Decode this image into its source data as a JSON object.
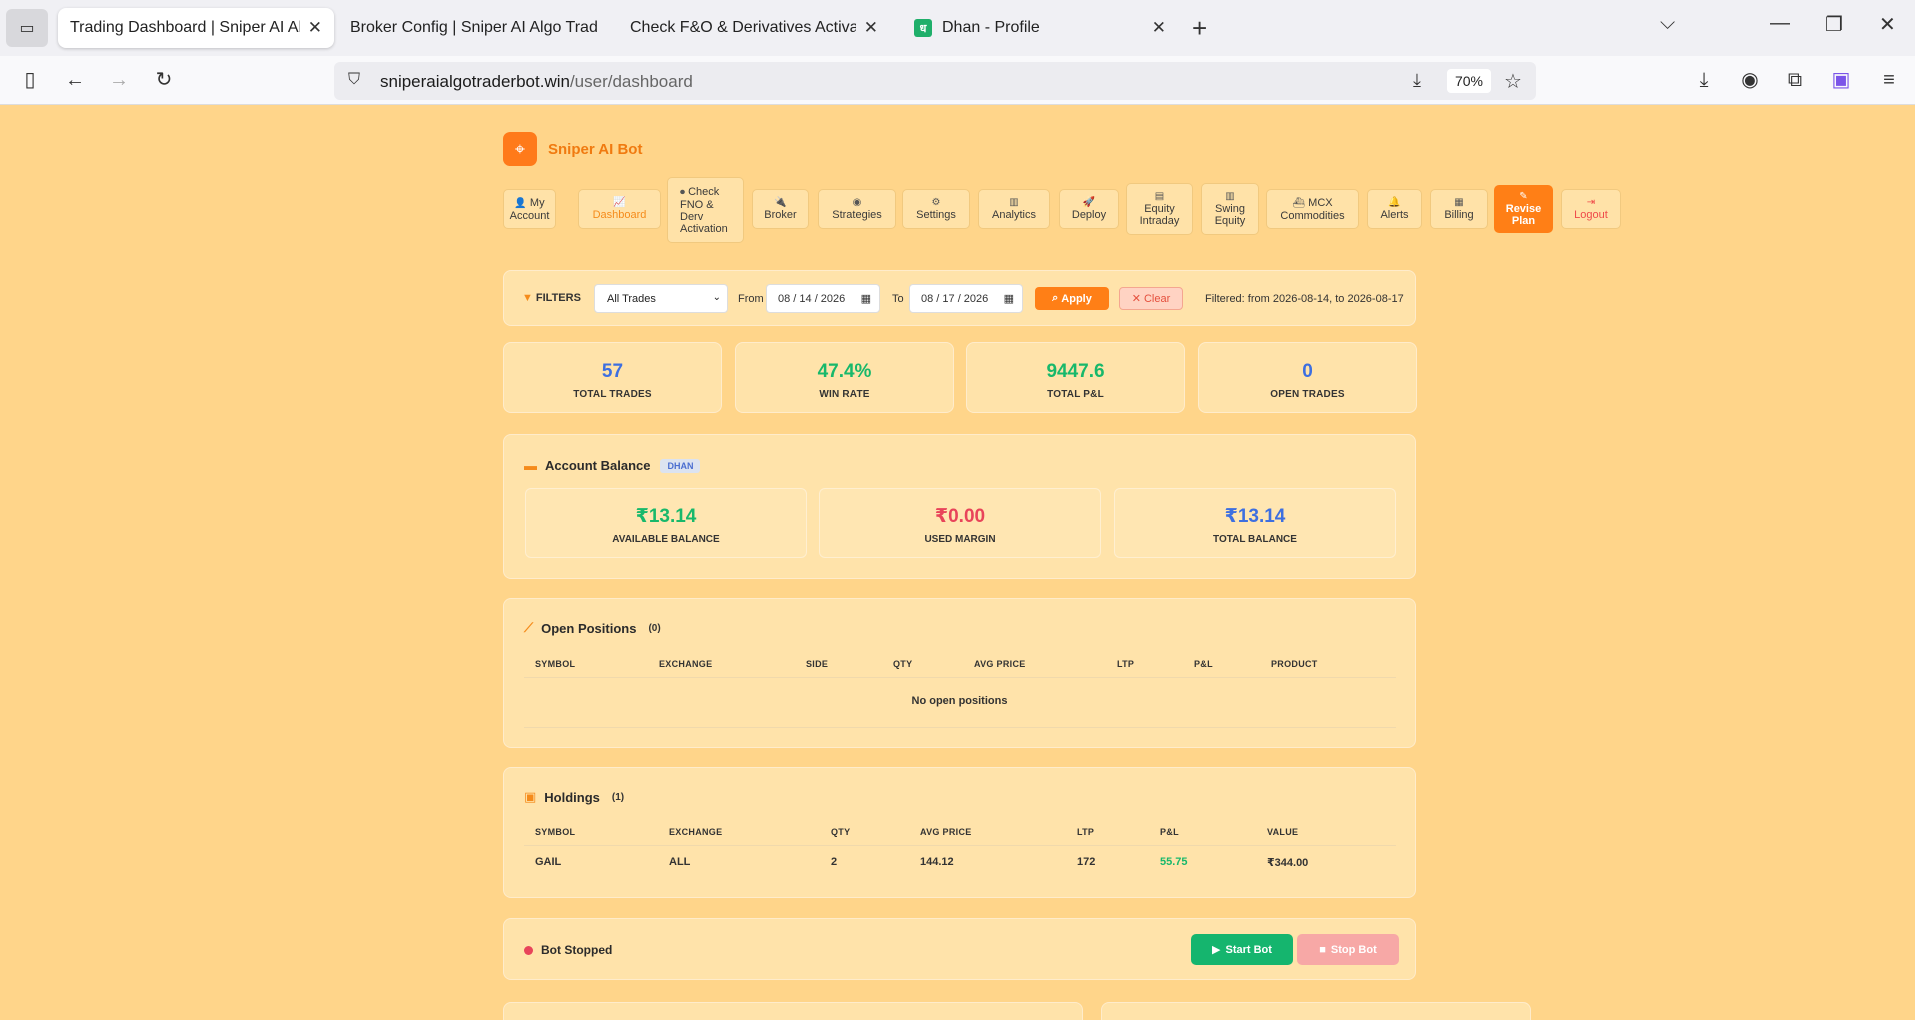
{
  "browser": {
    "tabs": [
      {
        "title": "Trading Dashboard | Sniper AI Algo",
        "active": true
      },
      {
        "title": "Broker Config | Sniper AI Algo Trade",
        "active": false
      },
      {
        "title": "Check F&O & Derivatives Activation",
        "active": false
      },
      {
        "title": "Dhan - Profile",
        "active": false
      }
    ],
    "url_domain": "sniperaialgotraderbot.win",
    "url_path": "/user/dashboard",
    "zoom": "70%"
  },
  "brand": {
    "name": "Sniper AI Bot"
  },
  "menu": [
    {
      "line1": "My",
      "line2": "Account",
      "icon": "user-icon",
      "glyph": "👤"
    },
    {
      "line1": "",
      "line2": "Dashboard",
      "icon": "chart-icon",
      "glyph": "📈",
      "active": true
    },
    {
      "line1": "Check",
      "line2": "FNO & Derv Activation",
      "icon": "toggle-icon",
      "glyph": "⏺"
    },
    {
      "line1": "",
      "line2": "Broker",
      "icon": "plug-icon",
      "glyph": "🔌"
    },
    {
      "line1": "",
      "line2": "Strategies",
      "icon": "brain-icon",
      "glyph": "◉"
    },
    {
      "line1": "",
      "line2": "Settings",
      "icon": "gear-icon",
      "glyph": "⚙"
    },
    {
      "line1": "",
      "line2": "Analytics",
      "icon": "analytics-icon",
      "glyph": "▥"
    },
    {
      "line1": "",
      "line2": "Deploy",
      "icon": "rocket-icon",
      "glyph": "🚀"
    },
    {
      "line1": "Equity",
      "line2": "Intraday",
      "icon": "line-chart-icon",
      "glyph": "▤"
    },
    {
      "line1": "Swing",
      "line2": "Equity",
      "icon": "bar-chart-icon",
      "glyph": "▥"
    },
    {
      "line1": "MCX",
      "line2": "Commodities",
      "icon": "ship-icon",
      "glyph": "⛴"
    },
    {
      "line1": "",
      "line2": "Alerts",
      "icon": "bell-icon",
      "glyph": "🔔"
    },
    {
      "line1": "",
      "line2": "Billing",
      "icon": "invoice-icon",
      "glyph": "▦"
    },
    {
      "line1": "Revise",
      "line2": "Plan",
      "icon": "edit-icon",
      "glyph": "✎"
    },
    {
      "line1": "",
      "line2": "Logout",
      "icon": "logout-icon",
      "glyph": "⇥"
    }
  ],
  "filters": {
    "label": "FILTERS",
    "trade_type": "All Trades",
    "from_label": "From",
    "from_date": "08 / 14 / 2026",
    "to_label": "To",
    "to_date": "08 / 17 / 2026",
    "apply_label": "Apply",
    "clear_label": "Clear",
    "status": "Filtered: from 2026-08-14, to 2026-08-17"
  },
  "stats": [
    {
      "value": "57",
      "label": "TOTAL TRADES",
      "color": "#3d6fe0"
    },
    {
      "value": "47.4%",
      "label": "WIN RATE",
      "color": "#18b86b"
    },
    {
      "value": "9447.6",
      "label": "TOTAL P&L",
      "color": "#18b86b"
    },
    {
      "value": "0",
      "label": "OPEN TRADES",
      "color": "#3d6fe0"
    }
  ],
  "balance": {
    "title": "Account Balance",
    "broker_tag": "DHAN",
    "items": [
      {
        "value": "₹13.14",
        "label": "AVAILABLE BALANCE",
        "color": "#18b86b"
      },
      {
        "value": "₹0.00",
        "label": "USED MARGIN",
        "color": "#e8445a"
      },
      {
        "value": "₹13.14",
        "label": "TOTAL BALANCE",
        "color": "#3d6fe0"
      }
    ]
  },
  "positions": {
    "title": "Open Positions",
    "count": "(0)",
    "columns": [
      "SYMBOL",
      "EXCHANGE",
      "SIDE",
      "QTY",
      "AVG PRICE",
      "LTP",
      "P&L",
      "PRODUCT"
    ],
    "empty_message": "No open positions"
  },
  "holdings": {
    "title": "Holdings",
    "count": "(1)",
    "columns": [
      "SYMBOL",
      "EXCHANGE",
      "QTY",
      "AVG PRICE",
      "LTP",
      "P&L",
      "VALUE"
    ],
    "rows": [
      {
        "symbol": "GAIL",
        "exchange": "ALL",
        "qty": "2",
        "avg_price": "144.12",
        "ltp": "172",
        "pnl": "55.75",
        "value": "₹344.00"
      }
    ]
  },
  "bot": {
    "status": "Bot Stopped",
    "start_label": "Start Bot",
    "stop_label": "Stop Bot"
  }
}
